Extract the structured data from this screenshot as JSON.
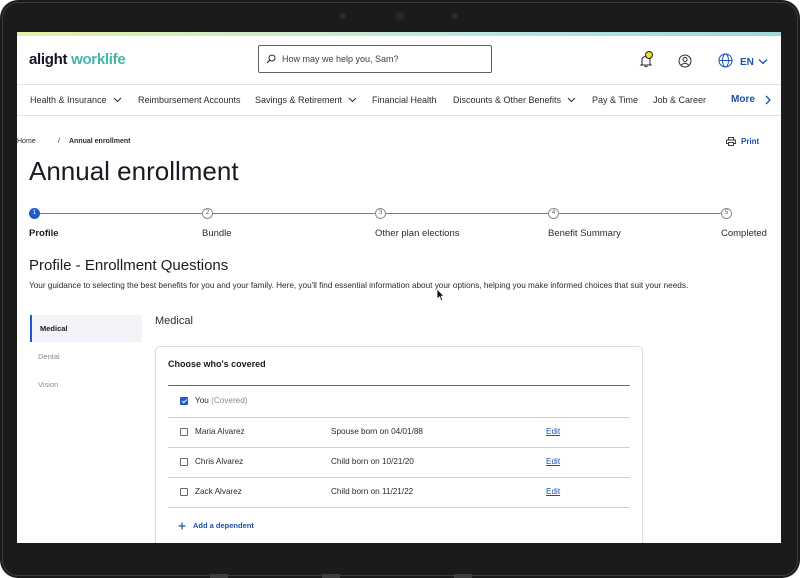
{
  "brand": {
    "logo_part1": "alight",
    "logo_part2": "worklife",
    "accent_color": "#2059c9",
    "link_color": "#1d4fae",
    "brand_teal": "#41b6a9"
  },
  "header": {
    "search_placeholder": "How may we help you, Sam?",
    "language": "EN"
  },
  "nav": {
    "items": [
      {
        "label": "Health & Insurance",
        "has_dropdown": true
      },
      {
        "label": "Reimbursement Accounts",
        "has_dropdown": false
      },
      {
        "label": "Savings & Retirement",
        "has_dropdown": true
      },
      {
        "label": "Financial Health",
        "has_dropdown": false
      },
      {
        "label": "Discounts & Other Benefits",
        "has_dropdown": true
      },
      {
        "label": "Pay & Time",
        "has_dropdown": false
      },
      {
        "label": "Job & Career",
        "has_dropdown": false
      }
    ],
    "more_label": "More"
  },
  "breadcrumb": {
    "home": "Home",
    "separator": "/",
    "current": "Annual enrollment"
  },
  "print_label": "Print",
  "page_title": "Annual enrollment",
  "stepper": {
    "steps": [
      {
        "number": "1",
        "label": "Profile",
        "active": true
      },
      {
        "number": "2",
        "label": "Bundle",
        "active": false
      },
      {
        "number": "3",
        "label": "Other plan elections",
        "active": false
      },
      {
        "number": "4",
        "label": "Benefit Summary",
        "active": false
      },
      {
        "number": "5",
        "label": "Completed",
        "active": false
      }
    ]
  },
  "section": {
    "title": "Profile - Enrollment Questions",
    "description": "Your guidance to selecting the best benefits for you and your family. Here, you'll find essential information about your options, helping you make informed choices that suit your needs."
  },
  "side_tabs": [
    {
      "label": "Medical",
      "active": true
    },
    {
      "label": "Dental",
      "active": false
    },
    {
      "label": "Vision",
      "active": false
    }
  ],
  "panel_title": "Medical",
  "card": {
    "title": "Choose who's covered",
    "self": {
      "name": "You",
      "status": "(Covered)",
      "checked": true
    },
    "dependents": [
      {
        "name": "Maria Alvarez",
        "relation": "Spouse born on 04/01/88",
        "edit": "Edit",
        "checked": false
      },
      {
        "name": "Chris Alvarez",
        "relation": "Child born on 10/21/20",
        "edit": "Edit",
        "checked": false
      },
      {
        "name": "Zack Alvarez",
        "relation": "Child born on 11/21/22",
        "edit": "Edit",
        "checked": false
      }
    ],
    "add_dependent": "Add a dependent"
  }
}
